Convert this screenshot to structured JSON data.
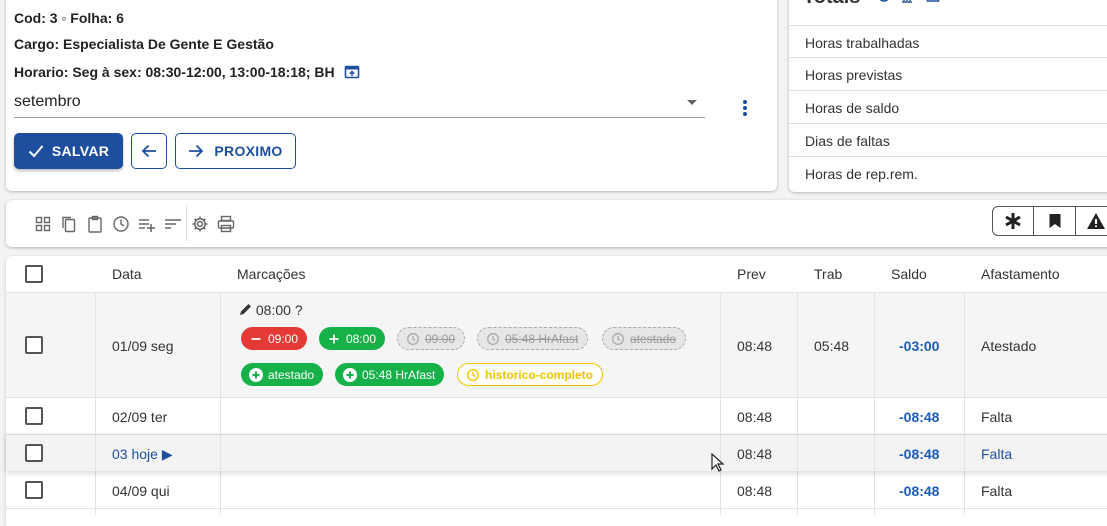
{
  "employee": {
    "cod_folha": "Cod: 3 ◦ Folha: 6",
    "cargo": "Cargo: Especialista De Gente E Gestão",
    "horario": "Horario: Seg à sex: 08:30-12:00, 13:00-18:18; BH",
    "month_select": "setembro"
  },
  "actions": {
    "save": "SALVAR",
    "next": "PROXIMO"
  },
  "totals": {
    "title": "Totais",
    "rows": [
      "Horas trabalhadas",
      "Horas previstas",
      "Horas de saldo",
      "Dias de faltas",
      "Horas de rep.rem."
    ]
  },
  "table": {
    "headers": {
      "data": "Data",
      "marcacoes": "Marcações",
      "prev": "Prev",
      "trab": "Trab",
      "saldo": "Saldo",
      "afastamento": "Afastamento"
    },
    "rows": [
      {
        "data": "01/09 seg",
        "prev": "08:48",
        "trab": "05:48",
        "saldo": "-03:00",
        "afastamento": "Atestado",
        "edit_note": "08:00 ?",
        "chips": [
          "09:00",
          "08:00",
          "09:00",
          "05:48 HrAfast",
          "atestado",
          "atestado",
          "05:48 HrAfast",
          "historico-completo"
        ]
      },
      {
        "data": "02/09 ter",
        "prev": "08:48",
        "trab": "",
        "saldo": "-08:48",
        "afastamento": "Falta"
      },
      {
        "data": "03 hoje ▶",
        "prev": "08:48",
        "trab": "",
        "saldo": "-08:48",
        "afastamento": "Falta"
      },
      {
        "data": "04/09 qui",
        "prev": "08:48",
        "trab": "",
        "saldo": "-08:48",
        "afastamento": "Falta"
      }
    ]
  },
  "colors": {
    "primary": "#1d4f9e",
    "red": "#e53935",
    "green": "#17b14a",
    "yellow": "#f2c200",
    "negative": "#1d5bb5"
  }
}
